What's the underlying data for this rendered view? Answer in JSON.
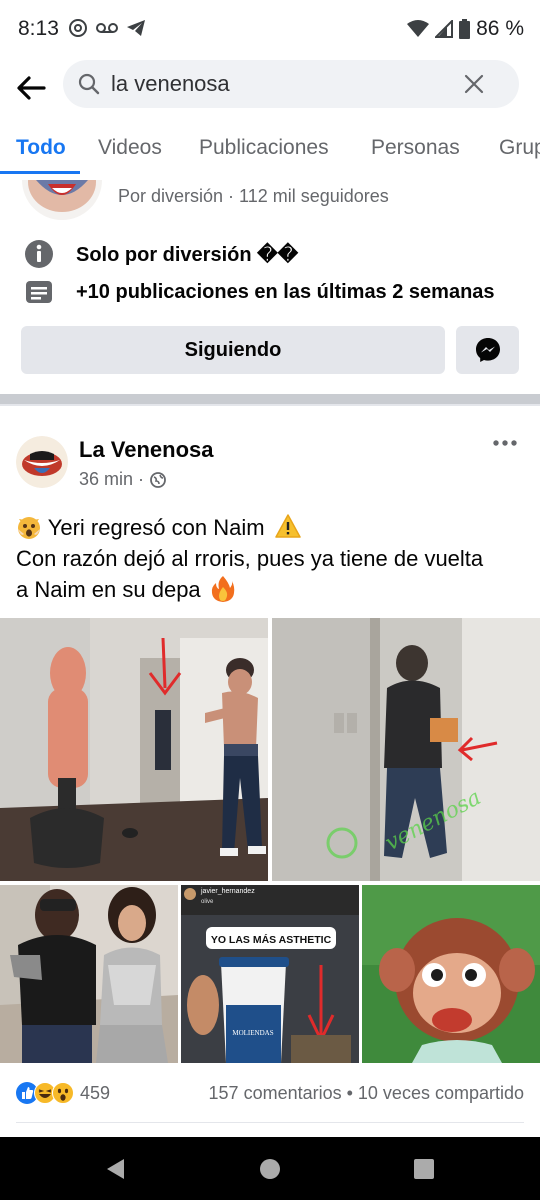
{
  "status": {
    "time": "8:13",
    "battery": "86 %"
  },
  "search": {
    "query": "la venenosa"
  },
  "tabs": [
    {
      "label": "Todo",
      "active": true
    },
    {
      "label": "Videos",
      "active": false
    },
    {
      "label": "Publicaciones",
      "active": false
    },
    {
      "label": "Personas",
      "active": false
    },
    {
      "label": "Grup",
      "active": false
    }
  ],
  "page_result": {
    "meta": "Por diversión · 112 mil seguidores",
    "info_1": "Solo por diversión ��",
    "info_2": "+10 publicaciones en las últimas 2 semanas",
    "follow_button": "Siguiendo"
  },
  "post": {
    "author": "La Venenosa",
    "time": "36 min ·",
    "text_line_1": "Yeri regresó con Naim",
    "text_line_2": "Con razón dejó al rroris, pues ya tiene de vuelta",
    "text_line_3": "a Naim en su depa",
    "photo_watermark": "venenosa",
    "photo_4_header": "javier_hernandez",
    "photo_4_subheader": "olive",
    "photo_4_caption": "YO LAS MÁS ASTHETIC",
    "photo_4_cup_brand": "MOLIENDAS",
    "reaction_count": "459",
    "engagement": "157 comentarios • 10 veces compartido"
  },
  "colors": {
    "accent": "#1877f2",
    "secondary_text": "#65676b",
    "button_bg": "#e4e6eb"
  }
}
